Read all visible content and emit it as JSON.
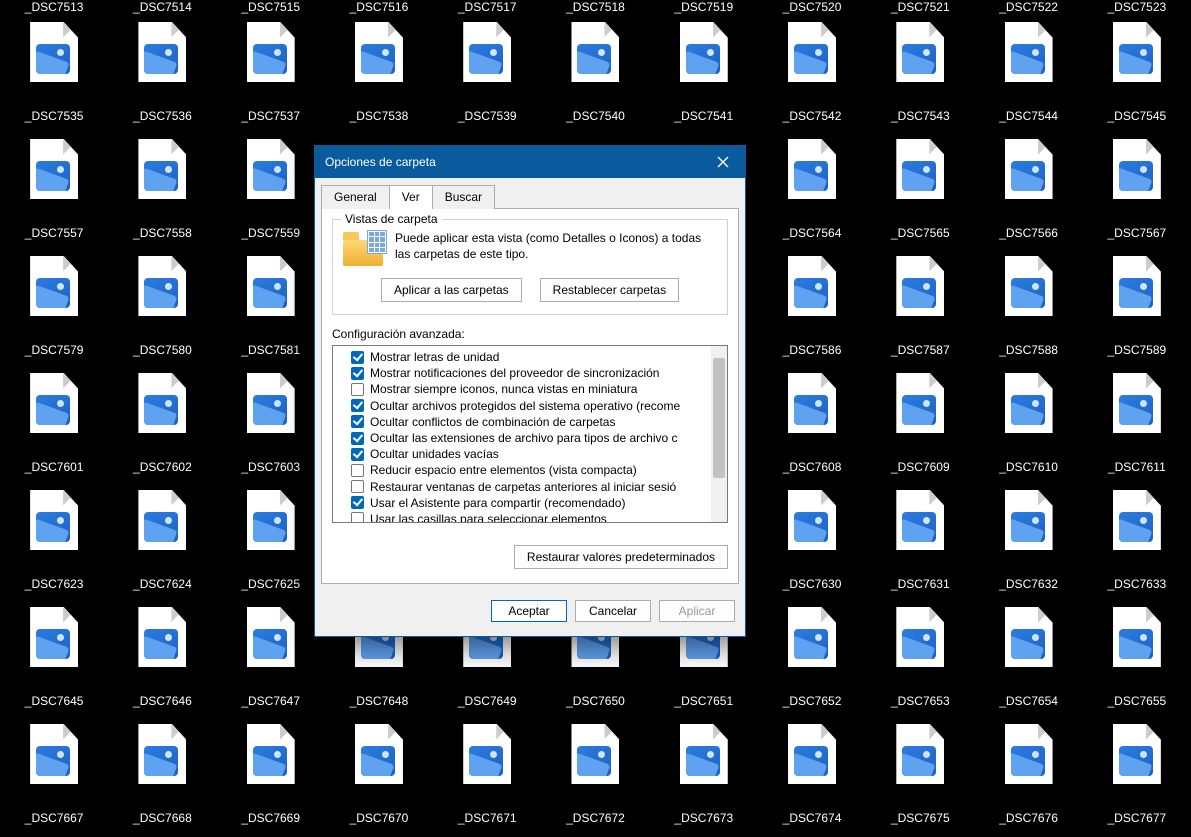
{
  "file_rows": [
    [
      "_DSC7513",
      "_DSC7514",
      "_DSC7515",
      "_DSC7516",
      "_DSC7517",
      "_DSC7518",
      "_DSC7519",
      "_DSC7520",
      "_DSC7521",
      "_DSC7522",
      "_DSC7523"
    ],
    [
      "_DSC7535",
      "_DSC7536",
      "_DSC7537",
      "_DSC7538",
      "_DSC7539",
      "_DSC7540",
      "_DSC7541",
      "_DSC7542",
      "_DSC7543",
      "_DSC7544",
      "_DSC7545"
    ],
    [
      "_DSC7557",
      "_DSC7558",
      "_DSC7559",
      "",
      "",
      "",
      "",
      "_DSC7564",
      "_DSC7565",
      "_DSC7566",
      "_DSC7567"
    ],
    [
      "_DSC7579",
      "_DSC7580",
      "_DSC7581",
      "",
      "",
      "",
      "",
      "_DSC7586",
      "_DSC7587",
      "_DSC7588",
      "_DSC7589"
    ],
    [
      "_DSC7601",
      "_DSC7602",
      "_DSC7603",
      "",
      "",
      "",
      "",
      "_DSC7608",
      "_DSC7609",
      "_DSC7610",
      "_DSC7611"
    ],
    [
      "_DSC7623",
      "_DSC7624",
      "_DSC7625",
      "",
      "",
      "",
      "",
      "_DSC7630",
      "_DSC7631",
      "_DSC7632",
      "_DSC7633"
    ],
    [
      "_DSC7645",
      "_DSC7646",
      "_DSC7647",
      "_DSC7648",
      "_DSC7649",
      "_DSC7650",
      "_DSC7651",
      "_DSC7652",
      "_DSC7653",
      "_DSC7654",
      "_DSC7655"
    ],
    [
      "_DSC7667",
      "_DSC7668",
      "_DSC7669",
      "_DSC7670",
      "_DSC7671",
      "_DSC7672",
      "_DSC7673",
      "_DSC7674",
      "_DSC7675",
      "_DSC7676",
      "_DSC7677"
    ]
  ],
  "dialog": {
    "title": "Opciones de carpeta",
    "tabs": {
      "general": "General",
      "ver": "Ver",
      "buscar": "Buscar"
    },
    "group_legend": "Vistas de carpeta",
    "group_text": "Puede aplicar esta vista (como Detalles o Iconos) a todas las carpetas de este tipo.",
    "apply_folders": "Aplicar a las carpetas",
    "reset_folders": "Restablecer carpetas",
    "advanced_label": "Configuración avanzada:",
    "advanced": [
      {
        "checked": true,
        "label": "Mostrar letras de unidad"
      },
      {
        "checked": true,
        "label": "Mostrar notificaciones del proveedor de sincronización"
      },
      {
        "checked": false,
        "label": "Mostrar siempre iconos, nunca vistas en miniatura"
      },
      {
        "checked": true,
        "label": "Ocultar archivos protegidos del sistema operativo (recome"
      },
      {
        "checked": true,
        "label": "Ocultar conflictos de combinación de carpetas"
      },
      {
        "checked": true,
        "label": "Ocultar las extensiones de archivo para tipos de archivo c"
      },
      {
        "checked": true,
        "label": "Ocultar unidades vacías"
      },
      {
        "checked": false,
        "label": "Reducir espacio entre elementos (vista compacta)"
      },
      {
        "checked": false,
        "label": "Restaurar ventanas de carpetas anteriores al iniciar sesió"
      },
      {
        "checked": true,
        "label": "Usar el Asistente para compartir (recomendado)"
      },
      {
        "checked": false,
        "label": "Usar las casillas para seleccionar elementos"
      }
    ],
    "restore_defaults": "Restaurar valores predeterminados",
    "ok": "Aceptar",
    "cancel": "Cancelar",
    "apply": "Aplicar"
  }
}
